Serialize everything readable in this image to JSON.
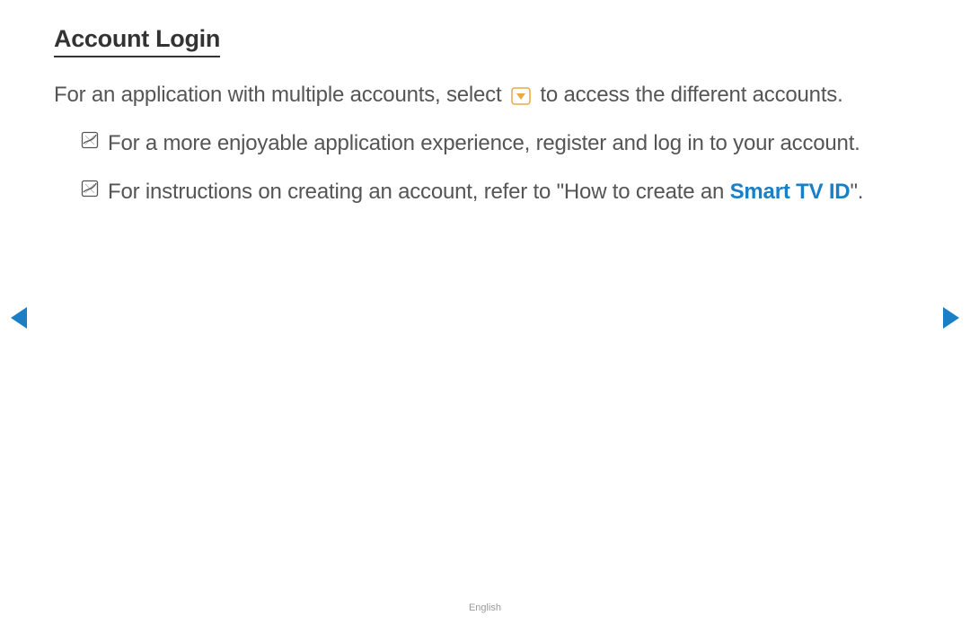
{
  "heading": "Account Login",
  "paragraph": {
    "pre": "For an application with multiple accounts, select ",
    "post": " to access the different accounts."
  },
  "notes": [
    {
      "text": "For a more enjoyable application experience, register and log in to your account."
    },
    {
      "pre": "For instructions on creating an account, refer to \"How to create an ",
      "link": "Smart TV ID",
      "post": "\"."
    }
  ],
  "footer": "English",
  "colors": {
    "link": "#1a7fc4",
    "nav": "#1a7fc4",
    "dropdown_border": "#e8a844",
    "dropdown_fill": "#e8a844"
  }
}
